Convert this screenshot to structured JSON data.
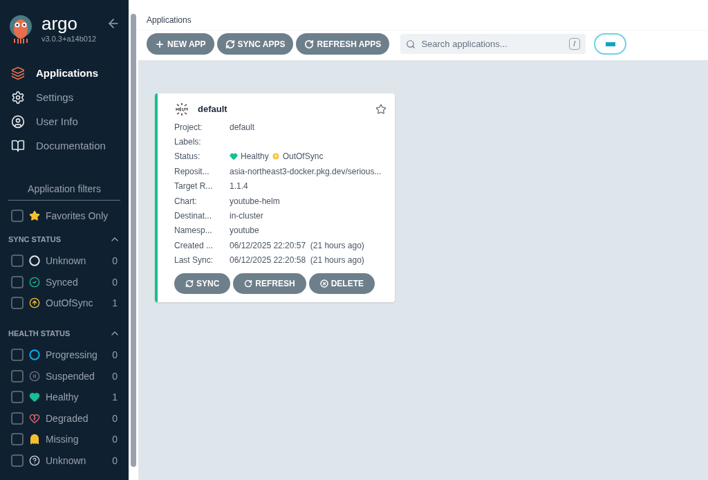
{
  "sidebar": {
    "logo_text": "argo",
    "version": "v3.0.3+a14b012",
    "nav": [
      {
        "label": "Applications",
        "kind": "layers",
        "selected": true
      },
      {
        "label": "Settings",
        "kind": "gears",
        "selected": false
      },
      {
        "label": "User Info",
        "kind": "user",
        "selected": false
      },
      {
        "label": "Documentation",
        "kind": "book",
        "selected": false
      }
    ],
    "filters_title": "Application filters",
    "favorites": {
      "label": "Favorites Only",
      "checked": false
    },
    "groups": [
      {
        "title": "SYNC STATUS",
        "expanded": true,
        "items": [
          {
            "label": "Unknown",
            "kind": "sync-unknown",
            "count": "0",
            "checked": false
          },
          {
            "label": "Synced",
            "kind": "synced",
            "count": "0",
            "checked": false
          },
          {
            "label": "OutOfSync",
            "kind": "outofsync",
            "count": "1",
            "checked": false
          }
        ]
      },
      {
        "title": "HEALTH STATUS",
        "expanded": true,
        "items": [
          {
            "label": "Progressing",
            "kind": "progressing",
            "count": "0",
            "checked": false
          },
          {
            "label": "Suspended",
            "kind": "suspended",
            "count": "0",
            "checked": false
          },
          {
            "label": "Healthy",
            "kind": "healthy",
            "count": "1",
            "checked": false
          },
          {
            "label": "Degraded",
            "kind": "degraded",
            "count": "0",
            "checked": false
          },
          {
            "label": "Missing",
            "kind": "missing",
            "count": "0",
            "checked": false
          },
          {
            "label": "Unknown",
            "kind": "health-unknown",
            "count": "0",
            "checked": false
          }
        ]
      }
    ]
  },
  "page_title": "Applications",
  "toolbar": {
    "buttons": [
      {
        "label": "NEW APP",
        "kind": "plus"
      },
      {
        "label": "SYNC APPS",
        "kind": "sync"
      },
      {
        "label": "REFRESH APPS",
        "kind": "refresh"
      }
    ],
    "search": {
      "placeholder": "Search applications...",
      "shortcut": "/"
    }
  },
  "app_card": {
    "name": "default",
    "favorite": false,
    "fields": [
      {
        "label": "Project:",
        "value": "default"
      },
      {
        "label": "Labels:"
      },
      {
        "label": "Status:",
        "kind": "status",
        "health": "Healthy",
        "sync": "OutOfSync"
      },
      {
        "label": "Reposit...",
        "value": "asia-northeast3-docker.pkg.dev/serious..."
      },
      {
        "label": "Target R...",
        "value": "1.1.4"
      },
      {
        "label": "Chart:",
        "value": "youtube-helm"
      },
      {
        "label": "Destinat...",
        "value": "in-cluster"
      },
      {
        "label": "Namesp...",
        "value": "youtube"
      },
      {
        "label": "Created ...",
        "value": "06/12/2025 22:20:57  (21 hours ago)"
      },
      {
        "label": "Last Sync:",
        "value": "06/12/2025 22:20:58  (21 hours ago)"
      }
    ],
    "buttons": [
      {
        "label": "SYNC",
        "kind": "sync"
      },
      {
        "label": "REFRESH",
        "kind": "refresh"
      },
      {
        "label": "DELETE",
        "kind": "delete"
      }
    ]
  }
}
